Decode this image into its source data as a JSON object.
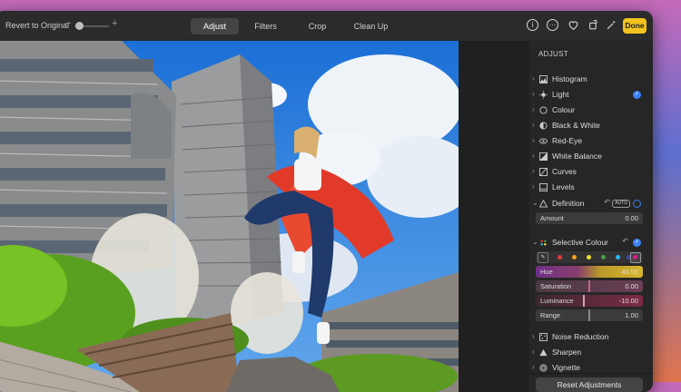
{
  "toolbar": {
    "revert_label": "Revert to Original",
    "zoom_minus": "−",
    "zoom_plus": "+",
    "tabs": [
      {
        "label": "Adjust",
        "active": true
      },
      {
        "label": "Filters",
        "active": false
      },
      {
        "label": "Crop",
        "active": false
      },
      {
        "label": "Clean Up",
        "active": false
      }
    ],
    "done_label": "Done"
  },
  "panel": {
    "heading": "ADJUST",
    "sections": {
      "histogram": {
        "label": "Histogram"
      },
      "light": {
        "label": "Light"
      },
      "colour": {
        "label": "Colour"
      },
      "black_white": {
        "label": "Black & White"
      },
      "red_eye": {
        "label": "Red-Eye"
      },
      "white_balance": {
        "label": "White Balance"
      },
      "curves": {
        "label": "Curves"
      },
      "levels": {
        "label": "Levels"
      },
      "definition": {
        "label": "Definition",
        "auto": "AUTO",
        "amount_label": "Amount",
        "amount_value": "0.00"
      },
      "selective_colour": {
        "label": "Selective Colour",
        "hue_label": "Hue",
        "hue_value": "40.00",
        "saturation_label": "Saturation",
        "saturation_value": "0.00",
        "luminance_label": "Luminance",
        "luminance_value": "-10.00",
        "range_label": "Range",
        "range_value": "1.00"
      },
      "noise_reduction": {
        "label": "Noise Reduction"
      },
      "sharpen": {
        "label": "Sharpen"
      },
      "vignette": {
        "label": "Vignette"
      }
    },
    "reset_label": "Reset Adjustments"
  },
  "colors": {
    "accent": "#3b82f6",
    "done": "#f2c41d",
    "swatches": [
      "#e53935",
      "#f4a020",
      "#f2e030",
      "#43a047",
      "#29b6f6",
      "#3949ab",
      "#d81b8a"
    ]
  }
}
